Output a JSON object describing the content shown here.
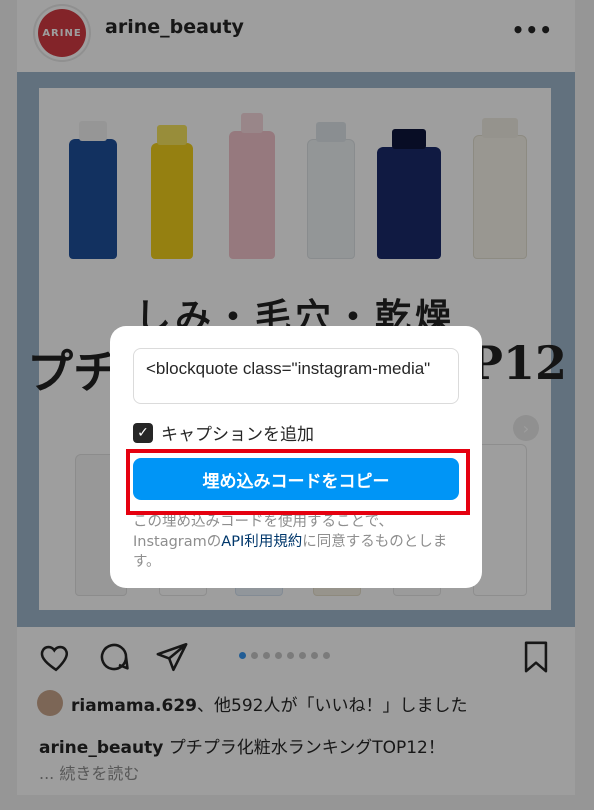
{
  "header": {
    "avatar_text": "ARINE",
    "username": "arine_beauty",
    "more": "•••"
  },
  "post": {
    "title_line1": "しみ・毛穴・乾燥",
    "title_line2_start": "プチ",
    "title_line2_end": "P12",
    "carousel_arrow": "›"
  },
  "modal": {
    "embed_code": "<blockquote class=\"instagram-media\"",
    "caption_checkbox_label": "キャプションを追加",
    "caption_checked": true,
    "copy_button_label": "埋め込みコードをコピー",
    "terms_prefix": "この埋め込みコードを使用することで、Instagramの",
    "terms_link": "API利用規約",
    "terms_suffix": "に同意するものとします。"
  },
  "actions": {
    "carousel_count": 8,
    "carousel_active": 0
  },
  "likes": {
    "username": "riamama.629",
    "text": "、他592人が「いいね！」しました"
  },
  "caption": {
    "username": "arine_beauty",
    "text": " プチプラ化粧水ランキングTOP12！",
    "more_label": "... 続きを読む"
  },
  "colors": {
    "primary_button": "#0095f6",
    "highlight_border": "#e5000f",
    "link": "#00376b"
  }
}
